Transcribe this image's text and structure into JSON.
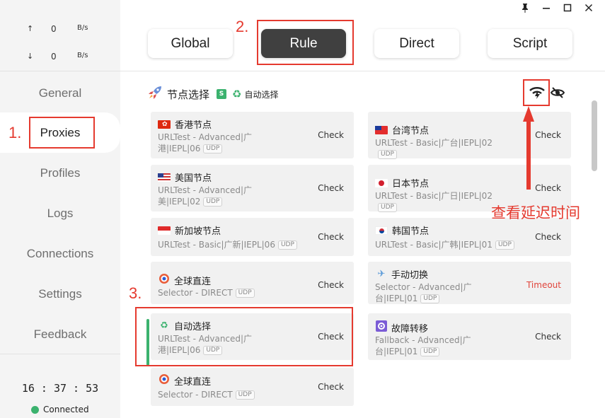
{
  "traffic": {
    "up_arrow": "↑",
    "up_value": "0",
    "up_unit": "B/s",
    "down_arrow": "↓",
    "down_value": "0",
    "down_unit": "B/s"
  },
  "sidebar": {
    "items": [
      {
        "label": "General"
      },
      {
        "label": "Proxies"
      },
      {
        "label": "Profiles"
      },
      {
        "label": "Logs"
      },
      {
        "label": "Connections"
      },
      {
        "label": "Settings"
      },
      {
        "label": "Feedback"
      }
    ],
    "clock": "16 : 37 : 53",
    "status": "Connected",
    "status_color": "#3bb26e"
  },
  "modes": [
    {
      "label": "Global"
    },
    {
      "label": "Rule"
    },
    {
      "label": "Direct"
    },
    {
      "label": "Script"
    }
  ],
  "group": {
    "name": "节点选择",
    "icon": "rocket-icon",
    "badge": "S",
    "selected": "自动选择"
  },
  "proxies": [
    {
      "name": "香港节点",
      "flag": "hk-flag",
      "desc": "URLTest - Advanced|广港|IEPL|06",
      "udp": "UDP",
      "status": "Check"
    },
    {
      "name": "台湾节点",
      "flag": "tw-flag",
      "desc": "URLTest - Basic|广台|IEPL|02",
      "udp": "UDP",
      "status": "Check"
    },
    {
      "name": "美国节点",
      "flag": "us-flag",
      "desc": "URLTest - Advanced|广美|IEPL|02",
      "udp": "UDP",
      "status": "Check"
    },
    {
      "name": "日本节点",
      "flag": "jp-flag",
      "desc": "URLTest - Basic|广日|IEPL|02",
      "udp": "UDP",
      "status": "Check"
    },
    {
      "name": "新加坡节点",
      "flag": "sg-flag",
      "desc": "URLTest - Basic|广新|IEPL|06",
      "udp": "UDP",
      "status": "Check"
    },
    {
      "name": "韩国节点",
      "flag": "kr-flag",
      "desc": "URLTest - Basic|广韩|IEPL|01",
      "udp": "UDP",
      "status": "Check"
    },
    {
      "name": "全球直连",
      "flag": "target-icon",
      "desc": "Selector - DIRECT",
      "udp": "UDP",
      "status": "Check"
    },
    {
      "name": "手动切换",
      "flag": "airplane-icon",
      "desc": "Selector - Advanced|广台|IEPL|01",
      "udp": "UDP",
      "status": "Timeout"
    },
    {
      "name": "自动选择",
      "flag": "recycle-icon",
      "desc": "URLTest - Advanced|广港|IEPL|06",
      "udp": "UDP",
      "status": "Check"
    },
    {
      "name": "故障转移",
      "flag": "gear-icon",
      "desc": "Fallback - Advanced|广台|IEPL|01",
      "udp": "UDP",
      "status": "Check"
    },
    {
      "name": "全球直连",
      "flag": "target-icon",
      "desc": "Selector - DIRECT",
      "udp": "UDP",
      "status": "Check"
    }
  ],
  "annotations": {
    "step1": "1.",
    "step2": "2.",
    "step3": "3.",
    "latency_note": "查看延迟时间"
  },
  "colors": {
    "accent_green": "#3bb26e",
    "annotation_red": "#e53a2f",
    "active_tab": "#404040",
    "timeout_red": "#e0443b"
  }
}
